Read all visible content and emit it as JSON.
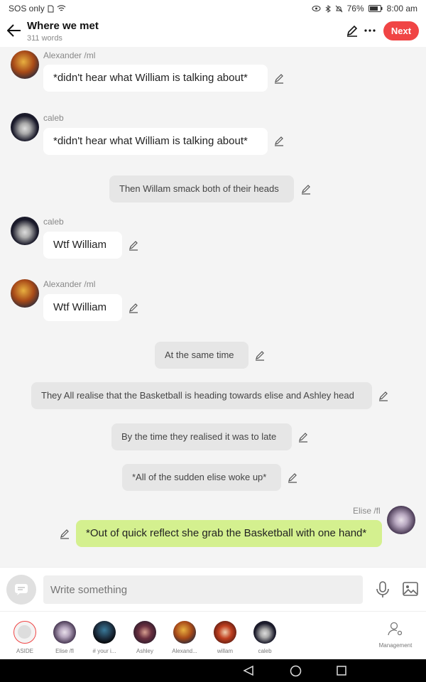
{
  "status": {
    "left": "SOS only",
    "battery": "76%",
    "time": "8:00 am"
  },
  "header": {
    "title": "Where we met",
    "word_count": "311 words",
    "next_label": "Next"
  },
  "messages": [
    {
      "name": "Alexander /ml",
      "text": "*didn't hear what  William is talking about*"
    },
    {
      "name": "caleb",
      "text": "*didn't hear what  William is talking about*"
    },
    {
      "text": "Then Willam smack both of their heads"
    },
    {
      "name": "caleb",
      "text": "Wtf William"
    },
    {
      "name": "Alexander /ml",
      "text": "Wtf William"
    },
    {
      "text": "At the same time"
    },
    {
      "text": "They All realise that the Basketball is heading towards elise and Ashley head"
    },
    {
      "text": "By the time they realised it was to late"
    },
    {
      "text": "*All of the sudden elise woke up*"
    },
    {
      "name": "Elise /fl",
      "text": "*Out of quick reflect she grab the Basketball with one hand*"
    }
  ],
  "composer": {
    "placeholder": "Write something"
  },
  "characters": [
    {
      "label": "ASIDE"
    },
    {
      "label": "Elise /fl"
    },
    {
      "label": "# your i..."
    },
    {
      "label": "Ashley"
    },
    {
      "label": "Alexand..."
    },
    {
      "label": "willam"
    },
    {
      "label": "caleb"
    }
  ],
  "management_label": "Management",
  "colors": {
    "accent": "#f04545",
    "user_bubble": "#d4f08f",
    "narration_bubble": "#e6e6e6"
  }
}
